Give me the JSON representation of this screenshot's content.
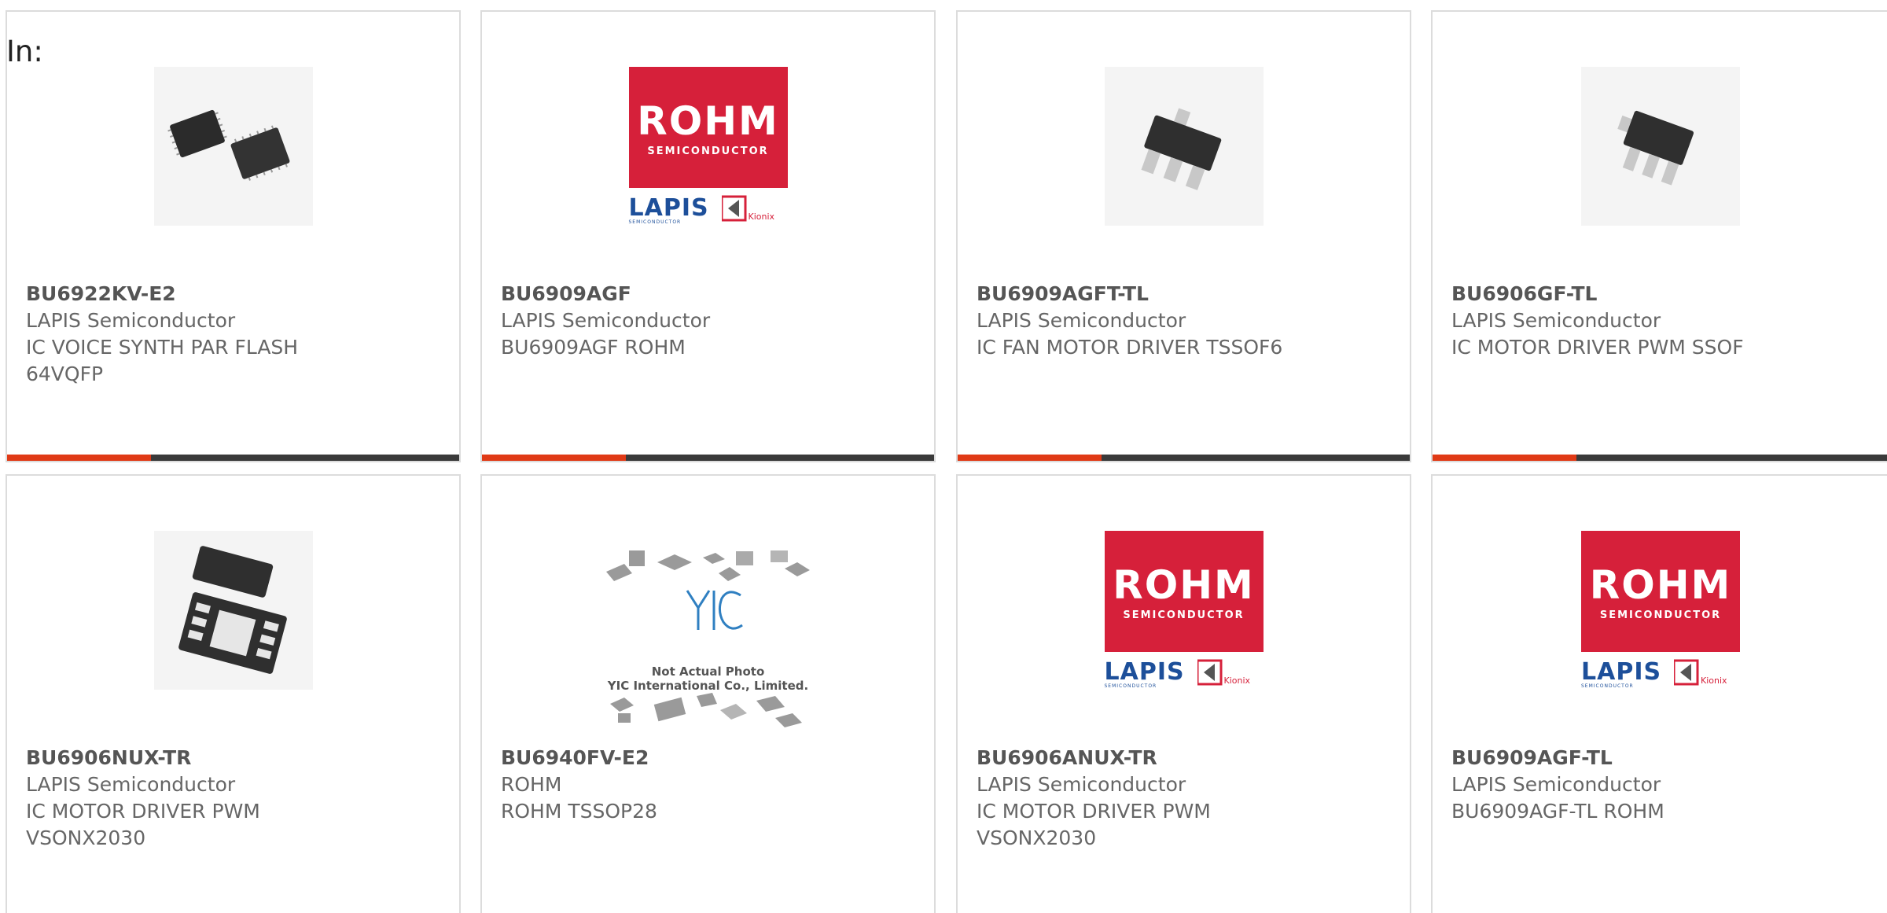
{
  "header": {
    "label": "In:"
  },
  "colors": {
    "accent": "#e03a16",
    "bar": "#3a3a3a",
    "brand_red": "#d6203a",
    "lapis_blue": "#1d4f9a"
  },
  "products": [
    {
      "part_number": "BU6922KV-E2",
      "manufacturer": "LAPIS Semiconductor",
      "description": "IC VOICE SYNTH PAR FLASH",
      "description_2": "64VQFP",
      "image": "qfp-chips-icon"
    },
    {
      "part_number": "BU6909AGF",
      "manufacturer": "LAPIS Semiconductor",
      "description": "BU6909AGF ROHM",
      "description_2": "",
      "image": "rohm-logo"
    },
    {
      "part_number": "BU6909AGFT-TL",
      "manufacturer": "LAPIS Semiconductor",
      "description": "IC FAN MOTOR DRIVER TSSOF6",
      "description_2": "",
      "image": "sot-chip-icon"
    },
    {
      "part_number": "BU6906GF-TL",
      "manufacturer": "LAPIS Semiconductor",
      "description": "IC MOTOR DRIVER PWM SSOF",
      "description_2": "",
      "image": "sot-chip-icon"
    },
    {
      "part_number": "BU6906NUX-TR",
      "manufacturer": "LAPIS Semiconductor",
      "description": "IC MOTOR DRIVER PWM",
      "description_2": "VSONX2030",
      "image": "son-chip-icon"
    },
    {
      "part_number": "BU6940FV-E2",
      "manufacturer": "ROHM",
      "description": "ROHM TSSOP28",
      "description_2": "",
      "image": "yic-placeholder",
      "image_caption_1": "Not Actual Photo",
      "image_caption_2": "YIC International Co., Limited."
    },
    {
      "part_number": "BU6906ANUX-TR",
      "manufacturer": "LAPIS Semiconductor",
      "description": "IC MOTOR DRIVER PWM",
      "description_2": "VSONX2030",
      "image": "rohm-logo"
    },
    {
      "part_number": "BU6909AGF-TL",
      "manufacturer": "LAPIS Semiconductor",
      "description": "BU6909AGF-TL ROHM",
      "description_2": "",
      "image": "rohm-logo"
    }
  ],
  "logo_text": {
    "rohm": "ROHM",
    "semiconductor": "SEMICONDUCTOR",
    "lapis": "LAPIS",
    "lapis_sub": "SEMICONDUCTOR",
    "kionix": "Kionix"
  }
}
